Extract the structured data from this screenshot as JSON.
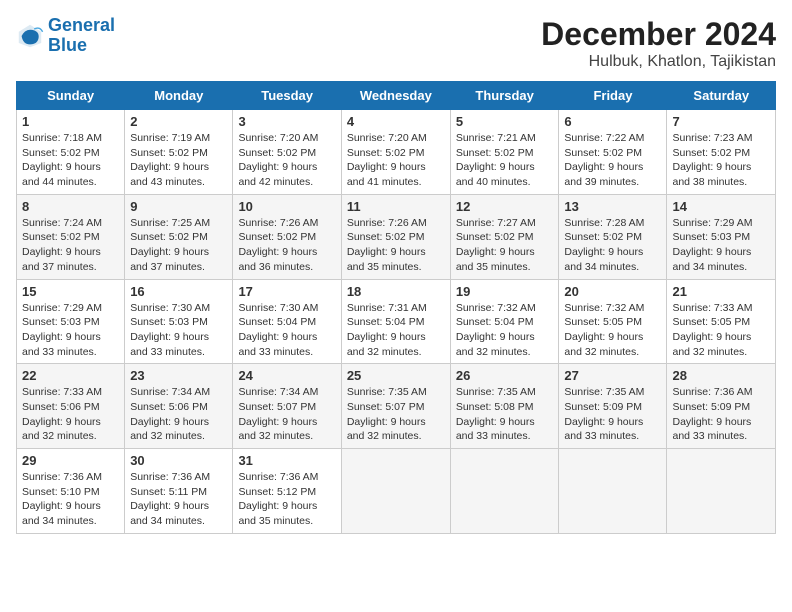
{
  "logo": {
    "line1": "General",
    "line2": "Blue"
  },
  "title": "December 2024",
  "subtitle": "Hulbuk, Khatlon, Tajikistan",
  "headers": [
    "Sunday",
    "Monday",
    "Tuesday",
    "Wednesday",
    "Thursday",
    "Friday",
    "Saturday"
  ],
  "weeks": [
    [
      {
        "day": "1",
        "sunrise": "7:18 AM",
        "sunset": "5:02 PM",
        "daylight": "9 hours and 44 minutes."
      },
      {
        "day": "2",
        "sunrise": "7:19 AM",
        "sunset": "5:02 PM",
        "daylight": "9 hours and 43 minutes."
      },
      {
        "day": "3",
        "sunrise": "7:20 AM",
        "sunset": "5:02 PM",
        "daylight": "9 hours and 42 minutes."
      },
      {
        "day": "4",
        "sunrise": "7:20 AM",
        "sunset": "5:02 PM",
        "daylight": "9 hours and 41 minutes."
      },
      {
        "day": "5",
        "sunrise": "7:21 AM",
        "sunset": "5:02 PM",
        "daylight": "9 hours and 40 minutes."
      },
      {
        "day": "6",
        "sunrise": "7:22 AM",
        "sunset": "5:02 PM",
        "daylight": "9 hours and 39 minutes."
      },
      {
        "day": "7",
        "sunrise": "7:23 AM",
        "sunset": "5:02 PM",
        "daylight": "9 hours and 38 minutes."
      }
    ],
    [
      {
        "day": "8",
        "sunrise": "7:24 AM",
        "sunset": "5:02 PM",
        "daylight": "9 hours and 37 minutes."
      },
      {
        "day": "9",
        "sunrise": "7:25 AM",
        "sunset": "5:02 PM",
        "daylight": "9 hours and 37 minutes."
      },
      {
        "day": "10",
        "sunrise": "7:26 AM",
        "sunset": "5:02 PM",
        "daylight": "9 hours and 36 minutes."
      },
      {
        "day": "11",
        "sunrise": "7:26 AM",
        "sunset": "5:02 PM",
        "daylight": "9 hours and 35 minutes."
      },
      {
        "day": "12",
        "sunrise": "7:27 AM",
        "sunset": "5:02 PM",
        "daylight": "9 hours and 35 minutes."
      },
      {
        "day": "13",
        "sunrise": "7:28 AM",
        "sunset": "5:02 PM",
        "daylight": "9 hours and 34 minutes."
      },
      {
        "day": "14",
        "sunrise": "7:29 AM",
        "sunset": "5:03 PM",
        "daylight": "9 hours and 34 minutes."
      }
    ],
    [
      {
        "day": "15",
        "sunrise": "7:29 AM",
        "sunset": "5:03 PM",
        "daylight": "9 hours and 33 minutes."
      },
      {
        "day": "16",
        "sunrise": "7:30 AM",
        "sunset": "5:03 PM",
        "daylight": "9 hours and 33 minutes."
      },
      {
        "day": "17",
        "sunrise": "7:30 AM",
        "sunset": "5:04 PM",
        "daylight": "9 hours and 33 minutes."
      },
      {
        "day": "18",
        "sunrise": "7:31 AM",
        "sunset": "5:04 PM",
        "daylight": "9 hours and 32 minutes."
      },
      {
        "day": "19",
        "sunrise": "7:32 AM",
        "sunset": "5:04 PM",
        "daylight": "9 hours and 32 minutes."
      },
      {
        "day": "20",
        "sunrise": "7:32 AM",
        "sunset": "5:05 PM",
        "daylight": "9 hours and 32 minutes."
      },
      {
        "day": "21",
        "sunrise": "7:33 AM",
        "sunset": "5:05 PM",
        "daylight": "9 hours and 32 minutes."
      }
    ],
    [
      {
        "day": "22",
        "sunrise": "7:33 AM",
        "sunset": "5:06 PM",
        "daylight": "9 hours and 32 minutes."
      },
      {
        "day": "23",
        "sunrise": "7:34 AM",
        "sunset": "5:06 PM",
        "daylight": "9 hours and 32 minutes."
      },
      {
        "day": "24",
        "sunrise": "7:34 AM",
        "sunset": "5:07 PM",
        "daylight": "9 hours and 32 minutes."
      },
      {
        "day": "25",
        "sunrise": "7:35 AM",
        "sunset": "5:07 PM",
        "daylight": "9 hours and 32 minutes."
      },
      {
        "day": "26",
        "sunrise": "7:35 AM",
        "sunset": "5:08 PM",
        "daylight": "9 hours and 33 minutes."
      },
      {
        "day": "27",
        "sunrise": "7:35 AM",
        "sunset": "5:09 PM",
        "daylight": "9 hours and 33 minutes."
      },
      {
        "day": "28",
        "sunrise": "7:36 AM",
        "sunset": "5:09 PM",
        "daylight": "9 hours and 33 minutes."
      }
    ],
    [
      {
        "day": "29",
        "sunrise": "7:36 AM",
        "sunset": "5:10 PM",
        "daylight": "9 hours and 34 minutes."
      },
      {
        "day": "30",
        "sunrise": "7:36 AM",
        "sunset": "5:11 PM",
        "daylight": "9 hours and 34 minutes."
      },
      {
        "day": "31",
        "sunrise": "7:36 AM",
        "sunset": "5:12 PM",
        "daylight": "9 hours and 35 minutes."
      },
      null,
      null,
      null,
      null
    ]
  ]
}
